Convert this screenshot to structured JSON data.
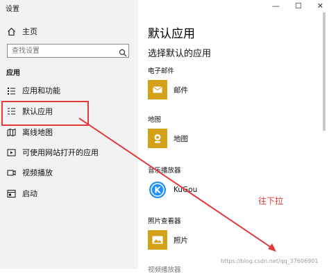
{
  "window": {
    "title": "设置",
    "controls": {
      "minimize": "—",
      "maximize": "☐",
      "close": "✕"
    }
  },
  "sidebar": {
    "home_label": "主页",
    "search": {
      "placeholder": "查找设置",
      "value": ""
    },
    "section_title": "应用",
    "items": [
      {
        "label": "应用和功能",
        "icon": "list-icon"
      },
      {
        "label": "默认应用",
        "icon": "default-apps-icon"
      },
      {
        "label": "离线地图",
        "icon": "map-icon"
      },
      {
        "label": "可使用网站打开的应用",
        "icon": "website-app-icon"
      },
      {
        "label": "视频播放",
        "icon": "video-icon"
      },
      {
        "label": "启动",
        "icon": "startup-icon"
      }
    ]
  },
  "main": {
    "title": "默认应用",
    "subtitle": "选择默认的应用",
    "categories": [
      {
        "label": "电子邮件",
        "app": "邮件",
        "icon": "mail-icon",
        "color": "#d4a017"
      },
      {
        "label": "地图",
        "app": "地图",
        "icon": "maps-icon",
        "color": "#d4a017"
      },
      {
        "label": "音乐播放器",
        "app": "KuGou",
        "icon": "kugou-icon",
        "color": "#1e90ff"
      },
      {
        "label": "照片查看器",
        "app": "照片",
        "icon": "photos-icon",
        "color": "#d4a017"
      }
    ],
    "next_category_partial": "视频播放器"
  },
  "annotation": {
    "text": "往下拉",
    "color": "#e03a3a"
  },
  "watermark": "https://blog.csdn.net/qq_37606901"
}
